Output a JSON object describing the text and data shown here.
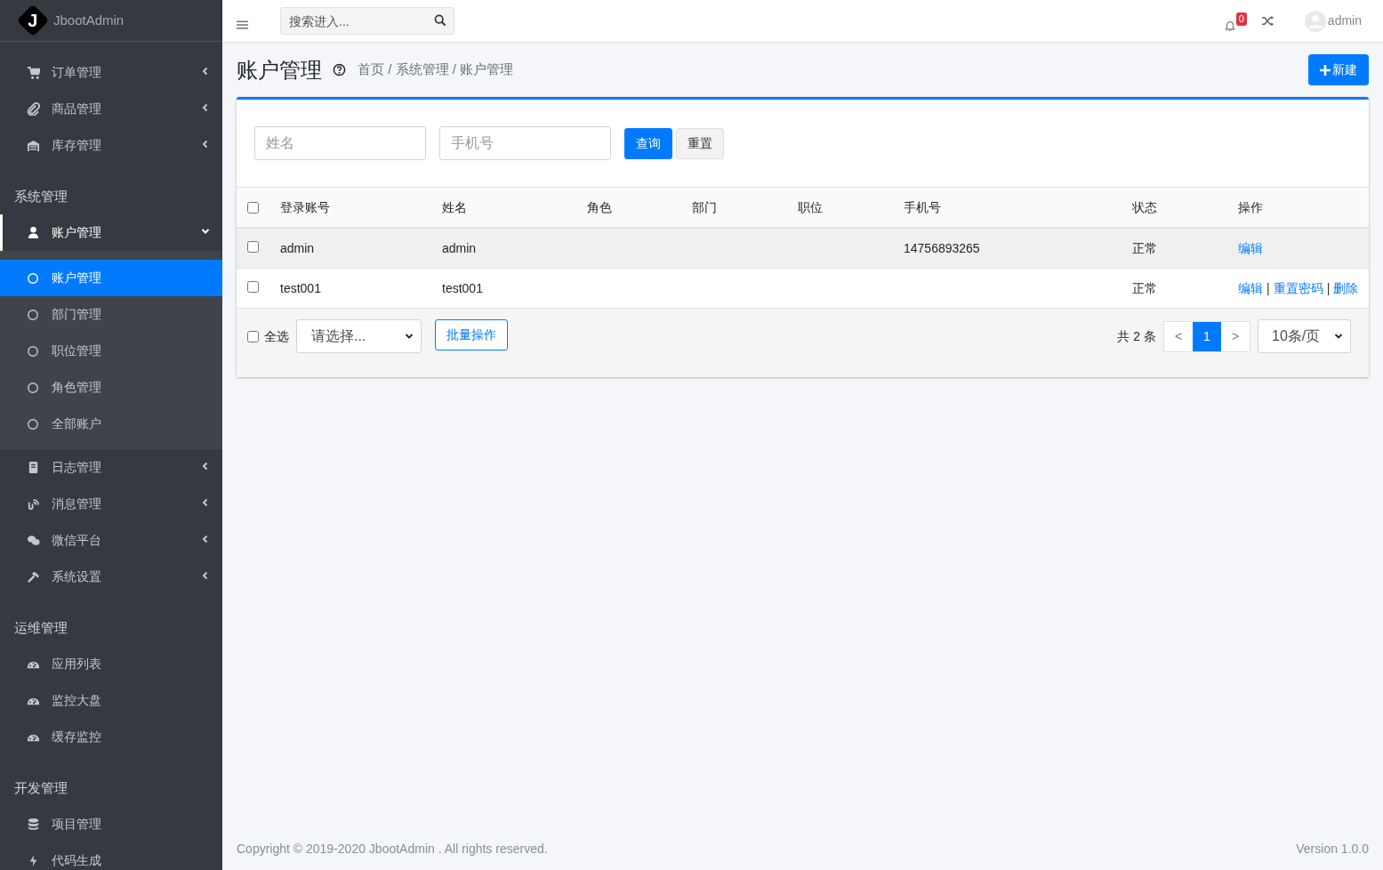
{
  "brand": {
    "logo_letter": "J",
    "name": "JbootAdmin"
  },
  "sidebar": {
    "sections": [
      {
        "items": [
          {
            "label": "订单管理",
            "selected": false,
            "expanded": false
          },
          {
            "label": "商品管理",
            "selected": false,
            "expanded": false
          },
          {
            "label": "库存管理",
            "selected": false,
            "expanded": false
          }
        ]
      },
      {
        "title": "系统管理",
        "items": [
          {
            "label": "账户管理",
            "selected": true,
            "expanded": true,
            "children": [
              {
                "label": "账户管理",
                "selected": true
              },
              {
                "label": "部门管理",
                "selected": false
              },
              {
                "label": "职位管理",
                "selected": false
              },
              {
                "label": "角色管理",
                "selected": false
              },
              {
                "label": "全部账户",
                "selected": false
              }
            ]
          },
          {
            "label": "日志管理",
            "selected": false,
            "expanded": false
          },
          {
            "label": "消息管理",
            "selected": false,
            "expanded": false
          },
          {
            "label": "微信平台",
            "selected": false,
            "expanded": false
          },
          {
            "label": "系统设置",
            "selected": false,
            "expanded": false
          }
        ]
      },
      {
        "title": "运维管理",
        "items": [
          {
            "label": "应用列表",
            "selected": false
          },
          {
            "label": "监控大盘",
            "selected": false
          },
          {
            "label": "缓存监控",
            "selected": false
          }
        ]
      },
      {
        "title": "开发管理",
        "items": [
          {
            "label": "项目管理",
            "selected": false
          },
          {
            "label": "代码生成",
            "selected": false
          }
        ]
      }
    ]
  },
  "header": {
    "search": {
      "placeholder": "搜索进入..."
    },
    "notifications": {
      "count": "0"
    },
    "user": {
      "name": "admin"
    }
  },
  "page": {
    "title": "账户管理",
    "breadcrumb": "首页 / 系统管理 / 账户管理",
    "new_button": "新建"
  },
  "filters": {
    "fields": [
      {
        "placeholder": "姓名"
      },
      {
        "placeholder": "手机号"
      }
    ],
    "buttons": [
      {
        "label": "查询",
        "kind": "primary"
      },
      {
        "label": "重置",
        "kind": "default"
      }
    ]
  },
  "table": {
    "header_checked": false,
    "columns": [
      "登录账号",
      "姓名",
      "角色",
      "部门",
      "职位",
      "手机号",
      "状态",
      "操作"
    ],
    "action_separator": "|",
    "rows": [
      {
        "checked": false,
        "highlighted": true,
        "login": "admin",
        "name": "admin",
        "phone": "14756893265",
        "status": "正常",
        "actions": [
          "编辑"
        ]
      },
      {
        "checked": false,
        "highlighted": false,
        "login": "test001",
        "name": "test001",
        "status": "正常",
        "actions": [
          "编辑",
          "重置密码",
          "删除"
        ]
      }
    ]
  },
  "table_footer": {
    "select_all": {
      "label": "全选",
      "checked": false
    },
    "bulk_select": {
      "value": "请选择..."
    },
    "bulk_button": "批量操作",
    "total": "共 2 条",
    "pages": [
      {
        "label": "<",
        "selected": false
      },
      {
        "label": "1",
        "selected": true
      },
      {
        "label": ">",
        "selected": false
      }
    ],
    "page_size": "10条/页"
  },
  "footer": {
    "copyright": "Copyright © 2019-2020 JbootAdmin . All rights reserved.",
    "version": "Version 1.0.0"
  }
}
